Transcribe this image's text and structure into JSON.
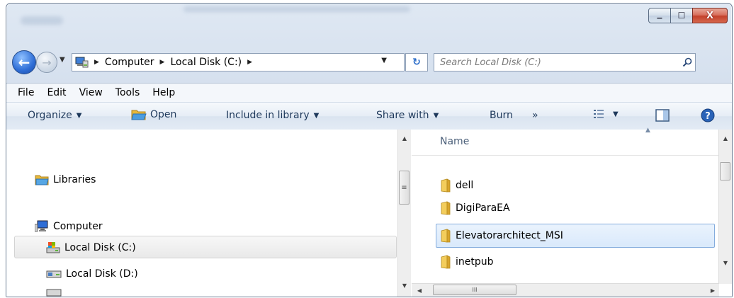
{
  "window": {
    "minimize_glyph": "▁",
    "maximize_glyph": "☐",
    "close_glyph": "X"
  },
  "address_bar": {
    "breadcrumb": [
      "Computer",
      "Local Disk (C:)"
    ],
    "separator": "▶",
    "dropdown_glyph": "▼",
    "refresh_glyph": "↻"
  },
  "search": {
    "placeholder": "Search Local Disk (C:)"
  },
  "menu": {
    "file": "File",
    "edit": "Edit",
    "view": "View",
    "tools": "Tools",
    "help": "Help"
  },
  "toolbar": {
    "organize": "Organize",
    "open": "Open",
    "include_in_library": "Include in library",
    "share_with": "Share with",
    "burn": "Burn",
    "more": "»",
    "dropdown_glyph": "▼"
  },
  "nav_pane": {
    "items": [
      {
        "label": "Libraries",
        "icon": "libraries-icon"
      },
      {
        "label": "Computer",
        "icon": "computer-icon"
      },
      {
        "label": "Local Disk (C:)",
        "icon": "local-disk-c-icon",
        "selected": true
      },
      {
        "label": "Local Disk (D:)",
        "icon": "local-disk-d-icon"
      }
    ]
  },
  "file_list": {
    "column_name": "Name",
    "items": [
      {
        "name": "dell",
        "selected": false
      },
      {
        "name": "DigiParaEA",
        "selected": false
      },
      {
        "name": "Elevatorarchitect_MSI",
        "selected": true
      },
      {
        "name": "inetpub",
        "selected": false
      }
    ]
  },
  "scroll": {
    "thumb_grip": "≡",
    "hthumb_grip": "III",
    "up": "▲",
    "down": "▼",
    "left": "◀",
    "right": "▶"
  },
  "colors": {
    "accent": "#2f6ed6",
    "selection_fill": "#d9e9fb",
    "selection_border": "#84acdd",
    "folder": "#e8b83a"
  }
}
